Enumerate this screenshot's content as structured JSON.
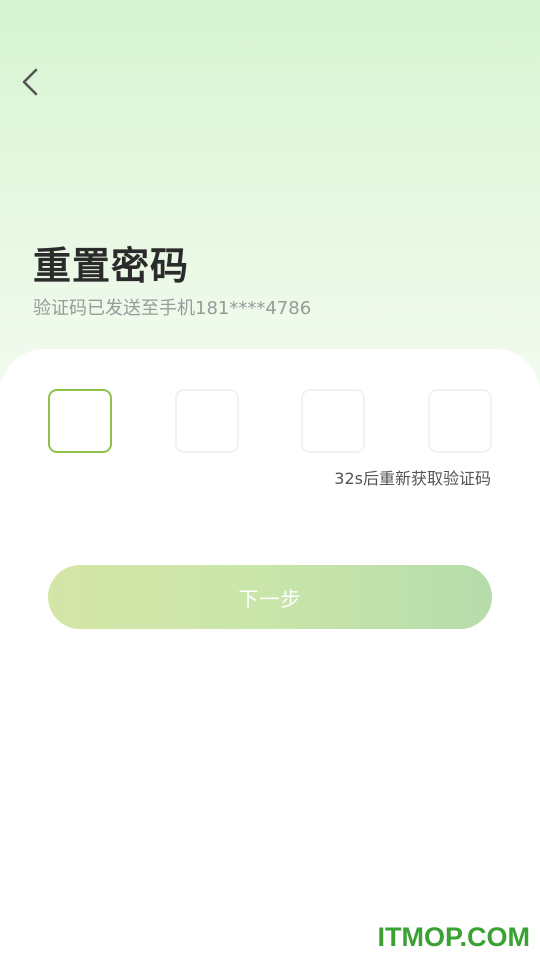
{
  "header": {
    "back_icon": "chevron-left-icon"
  },
  "page": {
    "title": "重置密码",
    "subtitle": "验证码已发送至手机181****4786"
  },
  "verification": {
    "code_boxes": [
      "",
      "",
      "",
      ""
    ],
    "active_index": 0,
    "resend_text": "32s后重新获取验证码"
  },
  "actions": {
    "next_label": "下一步"
  },
  "watermark": {
    "text": "ITMOP.COM"
  },
  "colors": {
    "accent_green": "#8cc24a",
    "button_gradient_start": "#d5e6a7",
    "button_gradient_end": "#b6dcab",
    "watermark_green": "#3aa133"
  }
}
